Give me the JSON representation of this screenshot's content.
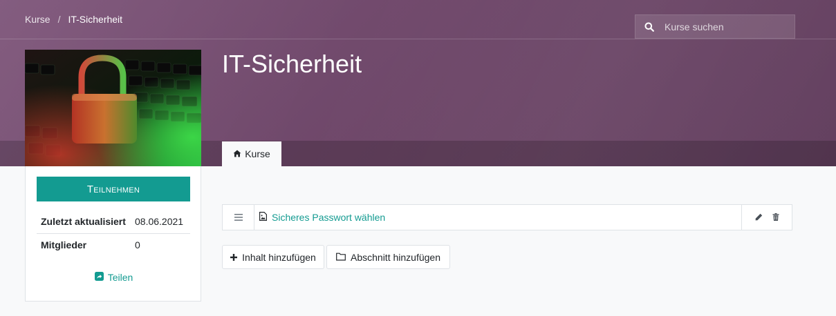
{
  "breadcrumb": {
    "parent": "Kurse",
    "separator": "/",
    "current": "IT-Sicherheit"
  },
  "search": {
    "placeholder": "Kurse suchen"
  },
  "course": {
    "title": "IT-Sicherheit"
  },
  "tabs": [
    {
      "label": "Kurse",
      "icon": "home-icon"
    }
  ],
  "sidebar": {
    "join_label": "Teilnehmen",
    "info": [
      {
        "label": "Zuletzt aktualisiert",
        "value": "08.06.2021"
      },
      {
        "label": "Mitglieder",
        "value": "0"
      }
    ],
    "share_label": "Teilen",
    "share_icon": "share-icon"
  },
  "content": {
    "items": [
      {
        "title": "Sicheres Passwort wählen",
        "icon": "image-file-icon"
      }
    ]
  },
  "actions": {
    "add_content": "Inhalt hinzufügen",
    "add_section": "Abschnitt hinzufügen"
  },
  "colors": {
    "header": "#74506f",
    "accent": "#139b91"
  }
}
